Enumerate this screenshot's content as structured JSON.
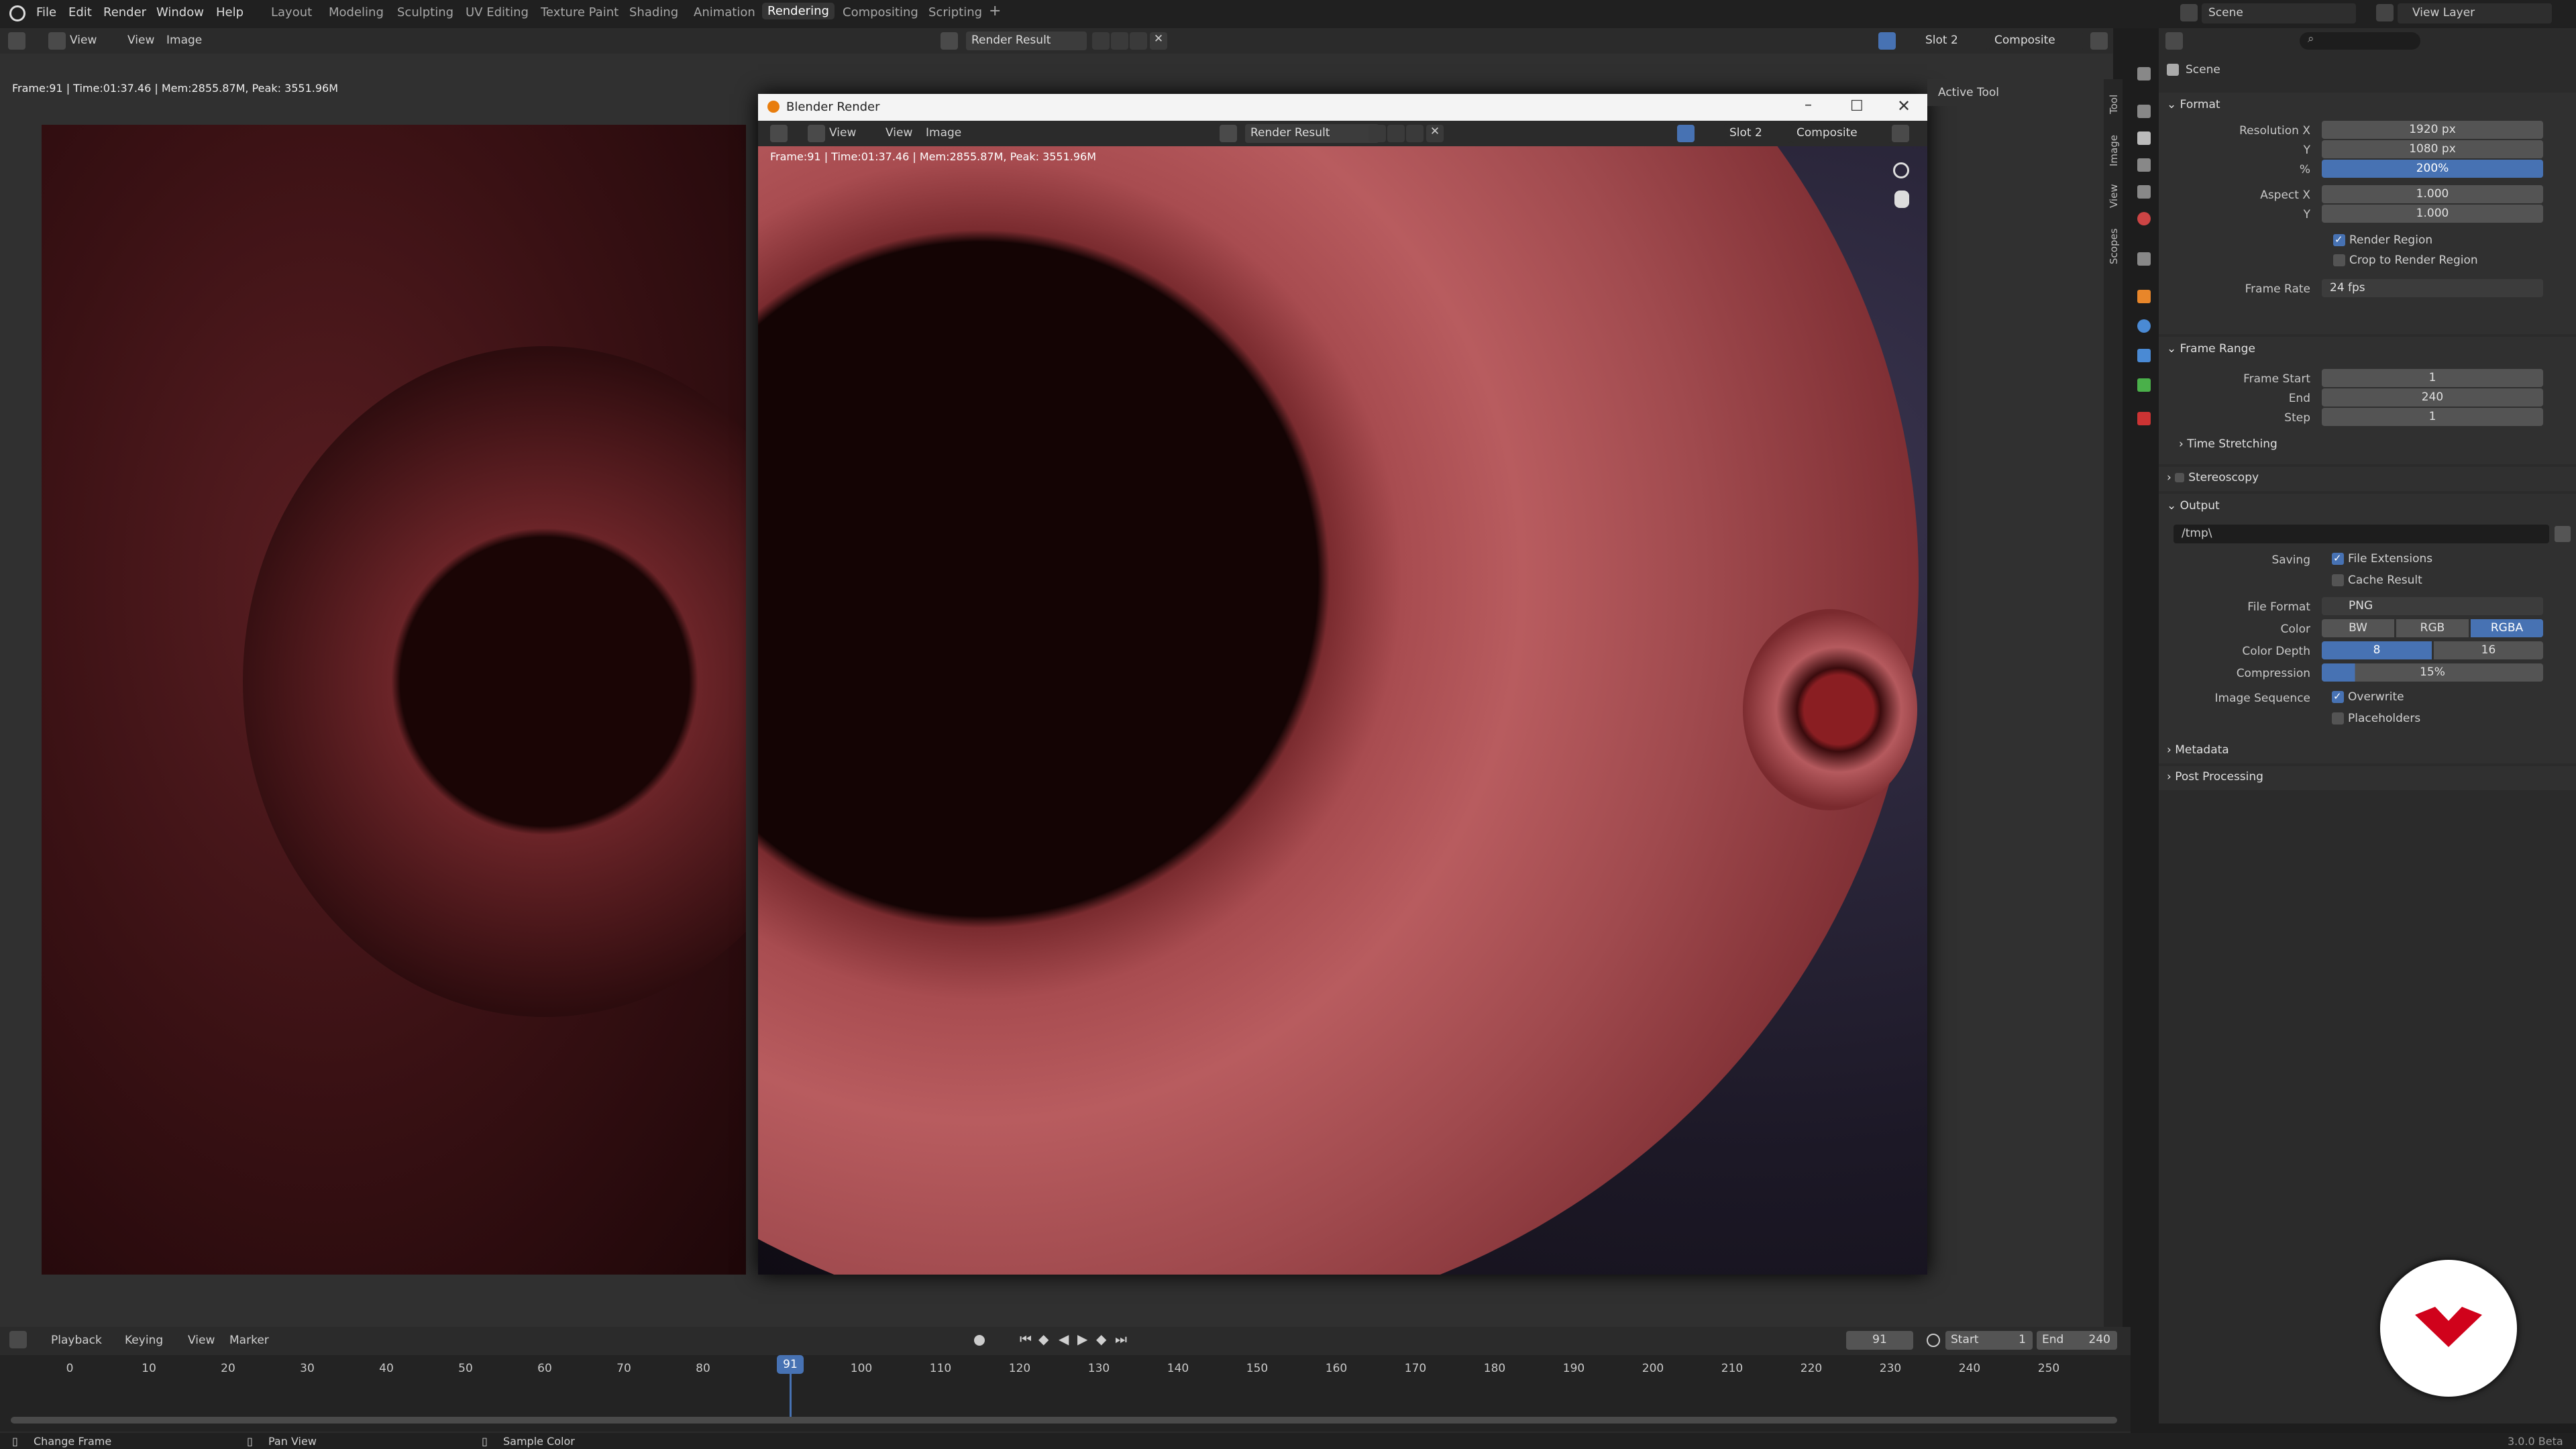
{
  "menu": {
    "file": "File",
    "edit": "Edit",
    "render": "Render",
    "window": "Window",
    "help": "Help"
  },
  "workspaces": [
    "Layout",
    "Modeling",
    "Sculpting",
    "UV Editing",
    "Texture Paint",
    "Shading",
    "Animation",
    "Rendering",
    "Compositing",
    "Scripting"
  ],
  "scene_selector": "Scene",
  "view_layer_selector": "View Layer",
  "image_editor": {
    "view_label": "View",
    "view2_label": "View",
    "image_label": "Image",
    "image_name": "Render Result",
    "slot": "Slot 2",
    "pass": "Composite",
    "stats": "Frame:91 | Time:01:37.46 | Mem:2855.87M, Peak: 3551.96M"
  },
  "render_window": {
    "title": "Blender Render",
    "view_label": "View",
    "view2_label": "View",
    "image_label": "Image",
    "image_name": "Render Result",
    "slot": "Slot 2",
    "pass": "Composite",
    "stats": "Frame:91 | Time:01:37.46 | Mem:2855.87M, Peak: 3551.96M"
  },
  "sidebar": {
    "active_tool": "Active Tool",
    "tabs": [
      "Tool",
      "Image",
      "View",
      "Scopes"
    ]
  },
  "properties": {
    "context": "Scene",
    "format": {
      "title": "Format",
      "res_x_label": "Resolution X",
      "res_x": "1920 px",
      "res_y_label": "Y",
      "res_y": "1080 px",
      "pct_label": "%",
      "pct": "200%",
      "aspect_x_label": "Aspect X",
      "aspect_x": "1.000",
      "aspect_y_label": "Y",
      "aspect_y": "1.000",
      "render_region": "Render Region",
      "crop": "Crop to Render Region",
      "frame_rate_label": "Frame Rate",
      "frame_rate": "24 fps"
    },
    "frame_range": {
      "title": "Frame Range",
      "start_label": "Frame Start",
      "start": "1",
      "end_label": "End",
      "end": "240",
      "step_label": "Step",
      "step": "1",
      "time_stretching": "Time Stretching"
    },
    "stereoscopy": "Stereoscopy",
    "output": {
      "title": "Output",
      "path": "/tmp\\",
      "saving_label": "Saving",
      "file_extensions": "File Extensions",
      "cache_result": "Cache Result",
      "file_format_label": "File Format",
      "file_format": "PNG",
      "color_label": "Color",
      "color_bw": "BW",
      "color_rgb": "RGB",
      "color_rgba": "RGBA",
      "depth_label": "Color Depth",
      "depth_8": "8",
      "depth_16": "16",
      "compression_label": "Compression",
      "compression": "15%",
      "image_sequence_label": "Image Sequence",
      "overwrite": "Overwrite",
      "placeholders": "Placeholders"
    },
    "metadata": "Metadata",
    "post_processing": "Post Processing"
  },
  "timeline": {
    "playback": "Playback",
    "keying": "Keying",
    "view": "View",
    "marker": "Marker",
    "current_frame": "91",
    "start_label": "Start",
    "start": "1",
    "end_label": "End",
    "end": "240",
    "ticks": [
      "0",
      "10",
      "20",
      "30",
      "40",
      "50",
      "60",
      "70",
      "80",
      "90",
      "100",
      "110",
      "120",
      "130",
      "140",
      "150",
      "160",
      "170",
      "180",
      "190",
      "200",
      "210",
      "220",
      "230",
      "240",
      "250"
    ],
    "playhead": "91"
  },
  "statusbar": {
    "change_frame": "Change Frame",
    "pan_view": "Pan View",
    "sample_color": "Sample Color",
    "version": "3.0.0 Beta"
  },
  "colors": {
    "accent": "#4772b3",
    "render_red": "#a04a4e",
    "noise": "#5a4f8a",
    "logo": "#d0021b"
  }
}
